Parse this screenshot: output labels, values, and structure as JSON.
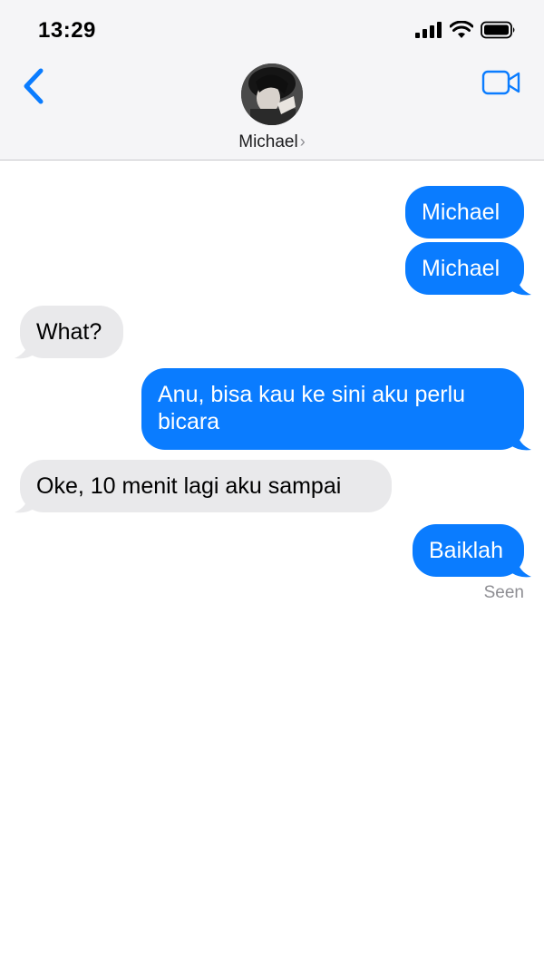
{
  "status_bar": {
    "time": "13:29",
    "icons": [
      "cellular-signal-icon",
      "wifi-icon",
      "battery-icon"
    ]
  },
  "header": {
    "contact_name": "Michael",
    "chevron": "›",
    "avatar_icon": "contact-avatar",
    "back_icon": "chevron-left-icon",
    "video_icon": "video-camera-icon"
  },
  "messages": [
    {
      "sender": "me",
      "text": "Michael"
    },
    {
      "sender": "me",
      "text": "Michael"
    },
    {
      "sender": "them",
      "text": "What?"
    },
    {
      "sender": "me",
      "text": "Anu, bisa kau ke sini aku perlu bicara"
    },
    {
      "sender": "them",
      "text": "Oke, 10 menit lagi aku sampai"
    },
    {
      "sender": "me",
      "text": "Baiklah"
    }
  ],
  "read_receipt": "Seen",
  "colors": {
    "accent": "#0a7cff",
    "received_bubble": "#e9e9eb",
    "header_bg": "#f5f5f7",
    "secondary_text": "#8e8e93"
  }
}
